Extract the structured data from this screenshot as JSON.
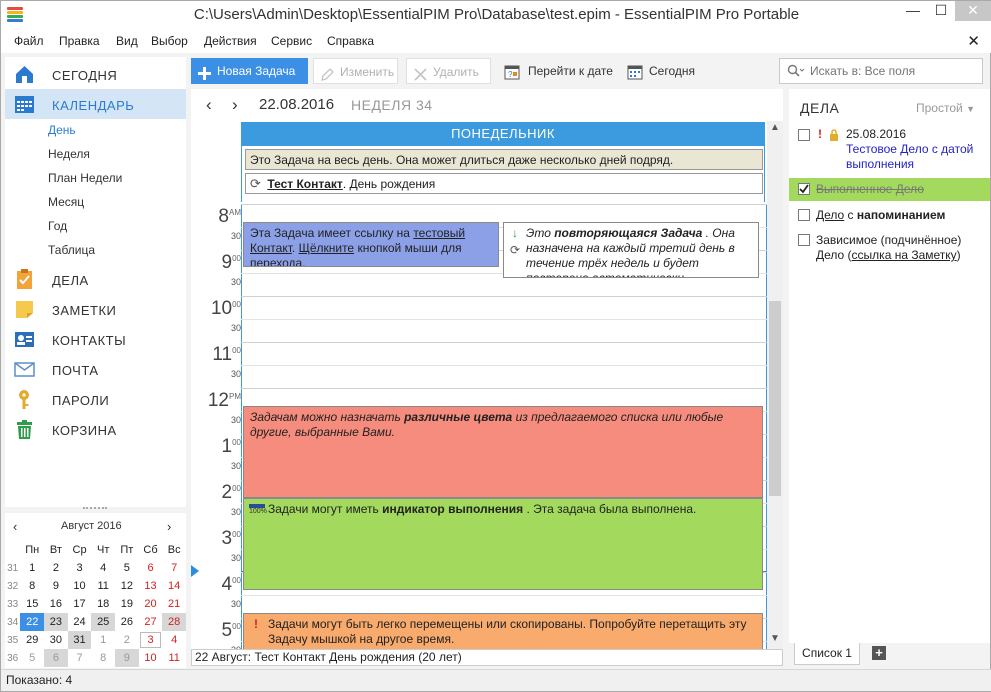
{
  "window": {
    "title": "C:\\Users\\Admin\\Desktop\\EssentialPIM Pro\\Database\\test.epim - EssentialPIM Pro Portable",
    "minimize": "—",
    "maximize": "☐",
    "close": "✕"
  },
  "menu": [
    "Файл",
    "Правка",
    "Вид",
    "Выбор",
    "Действия",
    "Сервис",
    "Справка"
  ],
  "menu_close": "✕",
  "nav": [
    {
      "label": "СЕГОДНЯ",
      "icon": "today-icon",
      "color": "#2a7bd0"
    },
    {
      "label": "КАЛЕНДАРЬ",
      "icon": "calendar-icon",
      "color": "#2a7bd0"
    },
    {
      "label": "ДЕЛА",
      "icon": "tasks-icon",
      "color": "#e58a1f"
    },
    {
      "label": "ЗАМЕТКИ",
      "icon": "notes-icon",
      "color": "#f0c24a"
    },
    {
      "label": "КОНТАКТЫ",
      "icon": "contacts-icon",
      "color": "#2a6fb8"
    },
    {
      "label": "ПОЧТА",
      "icon": "mail-icon",
      "color": "#5a8fc8"
    },
    {
      "label": "ПАРОЛИ",
      "icon": "key-icon",
      "color": "#d8a62a"
    },
    {
      "label": "КОРЗИНА",
      "icon": "trash-icon",
      "color": "#2e9d4a"
    }
  ],
  "calendar_views": [
    "День",
    "Неделя",
    "План Недели",
    "Месяц",
    "Год",
    "Таблица"
  ],
  "mini_calendar": {
    "month": "Август  2016",
    "weekdays": [
      "Пн",
      "Вт",
      "Ср",
      "Чт",
      "Пт",
      "Сб",
      "Вс"
    ],
    "weeks": [
      {
        "n": "31",
        "days": [
          "1",
          "2",
          "3",
          "4",
          "5",
          "6",
          "7"
        ]
      },
      {
        "n": "32",
        "days": [
          "8",
          "9",
          "10",
          "11",
          "12",
          "13",
          "14"
        ]
      },
      {
        "n": "33",
        "days": [
          "15",
          "16",
          "17",
          "18",
          "19",
          "20",
          "21"
        ]
      },
      {
        "n": "34",
        "days": [
          "22",
          "23",
          "24",
          "25",
          "26",
          "27",
          "28"
        ]
      },
      {
        "n": "35",
        "days": [
          "29",
          "30",
          "31",
          "1",
          "2",
          "3",
          "4"
        ]
      },
      {
        "n": "36",
        "days": [
          "5",
          "6",
          "7",
          "8",
          "9",
          "10",
          "11"
        ]
      }
    ]
  },
  "toolbar": {
    "new_task": "Новая Задача",
    "edit": "Изменить",
    "delete": "Удалить",
    "goto_date": "Перейти к дате",
    "today": "Сегодня"
  },
  "search": {
    "placeholder": "Искать в: Все поля"
  },
  "calendar": {
    "date": "22.08.2016",
    "week": "НЕДЕЛЯ 34",
    "day_name": "ПОНЕДЕЛЬНИК",
    "allday_task": "Это Задача на весь день. Она может длиться даже несколько дней подряд.",
    "birthday_contact": "Тест Контакт",
    "birthday_suffix": ". День рождения",
    "hours": [
      {
        "h": "8",
        "ampm": "AM"
      },
      {
        "h": "9",
        "ampm": ""
      },
      {
        "h": "10",
        "ampm": ""
      },
      {
        "h": "11",
        "ampm": ""
      },
      {
        "h": "12",
        "ampm": "PM"
      },
      {
        "h": "1",
        "ampm": ""
      },
      {
        "h": "2",
        "ampm": ""
      },
      {
        "h": "3",
        "ampm": ""
      },
      {
        "h": "4",
        "ampm": ""
      },
      {
        "h": "5",
        "ampm": ""
      }
    ],
    "minute_labels": {
      "zero": "00",
      "half": "30"
    },
    "events": {
      "link": {
        "a": "Эта Задача имеет ссылку на ",
        "link1": "тестовый Контакт",
        "b": ". ",
        "link2": "Щёлкните",
        "c": " кнопкой мыши для перехода."
      },
      "repeat": {
        "a": "Это ",
        "b": "повторяющаяся Задача",
        "c": " . Она назначена на каждый третий день в течение трёх недель и будет повторена автоматически."
      },
      "colors": {
        "a": "Задачам можно назначать ",
        "b": "различные цвета",
        "c": "  из предлагаемого списка или любые другие, выбранные Вами."
      },
      "progress": {
        "a": "Задачи могут иметь ",
        "b": "индикатор выполнения",
        "c": " . Эта задача была выполнена.",
        "pct": "100%",
        "value": 1
      },
      "move": {
        "mark": "!",
        "text": "Задачи могут быть легко перемещены или скопированы. Попробуйте перетащить эту Задачу мышкой на другое время."
      }
    },
    "status": "22 Август:  Тест Контакт День рождения  (20 лет)"
  },
  "colors": {
    "accent": "#3b9bde",
    "link_event": "#8ca0e8",
    "red_event": "#f58c7e",
    "green_event": "#a3d95c",
    "orange_event": "#f8ab6c",
    "done_task": "#a3d95c",
    "allday_bg": "#e9e6d4"
  },
  "todo": {
    "title": "ДЕЛА",
    "mode": "Простой",
    "items": [
      {
        "date": "25.08.2016",
        "text": "Тестовое Дело с датой выполнения"
      },
      {
        "text": "Выполненное Дело"
      },
      {
        "a": "Дело",
        "b": " с ",
        "c": "напоминанием"
      },
      {
        "a": "Зависимое (подчинённое) Дело (",
        "link": "ссылка на Заметку",
        "b": ")"
      }
    ],
    "tab": "Список 1",
    "add": "+"
  },
  "statusbar": "Показано: 4"
}
